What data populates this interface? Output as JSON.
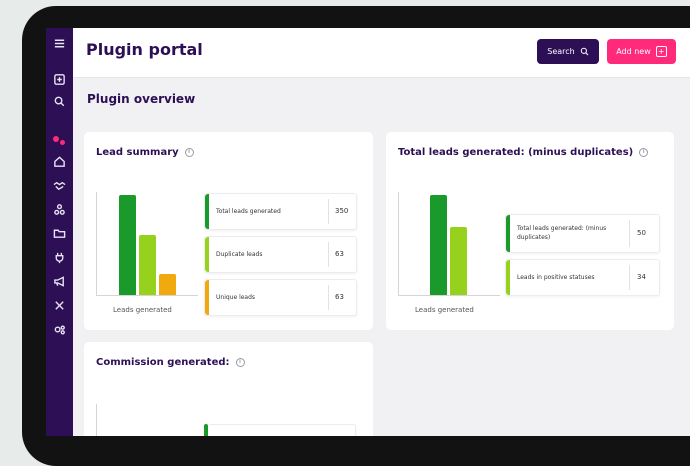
{
  "header": {
    "title": "Plugin portal",
    "search_label": "Search",
    "add_label": "Add new"
  },
  "section_title": "Plugin overview",
  "colors": {
    "sidebar": "#2d0f55",
    "accent_pink": "#ff2a7a",
    "green_dark": "#1a9a2b",
    "green_light": "#96d21d",
    "orange": "#f0a90f"
  },
  "sidebar_icons": [
    "menu-icon",
    "add-square-icon",
    "search-icon",
    "dots-logo-icon",
    "home-icon",
    "handshake-icon",
    "network-icon",
    "folder-icon",
    "plug-icon",
    "megaphone-icon",
    "tools-icon",
    "settings-icon"
  ],
  "lead_summary": {
    "title": "Lead summary",
    "caption": "Leads generated",
    "rows": [
      {
        "label": "Total leads generated",
        "value": "350"
      },
      {
        "label": "Duplicate leads",
        "value": "63"
      },
      {
        "label": "Unique leads",
        "value": "63"
      }
    ]
  },
  "total_leads": {
    "title": "Total leads generated: (minus duplicates)",
    "caption": "Leads generated",
    "rows": [
      {
        "label": "Total leads generated: (minus duplicates)",
        "value": "50"
      },
      {
        "label": "Leads in positive statuses",
        "value": "34"
      }
    ]
  },
  "commission": {
    "title": "Commission generated:"
  }
}
